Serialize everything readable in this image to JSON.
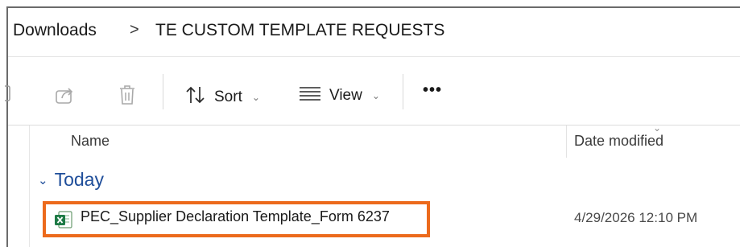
{
  "breadcrumb": {
    "items": [
      "Downloads",
      "TE CUSTOM TEMPLATE REQUESTS"
    ],
    "separator": ">"
  },
  "toolbar": {
    "share_icon": "share-icon",
    "delete_icon": "trash-icon",
    "sort_label": "Sort",
    "view_label": "View",
    "more_label": "•••"
  },
  "columns": {
    "name": "Name",
    "date_modified": "Date modified"
  },
  "groups": [
    {
      "label": "Today",
      "files": [
        {
          "name": "PEC_Supplier Declaration Template_Form 6237",
          "date_modified": "4/29/2026 12:10 PM",
          "icon": "excel-file-icon",
          "highlighted": true
        }
      ]
    }
  ],
  "colors": {
    "highlight": "#ec6a1c",
    "group_header": "#1f4e9a",
    "excel_green": "#1d7a45"
  }
}
